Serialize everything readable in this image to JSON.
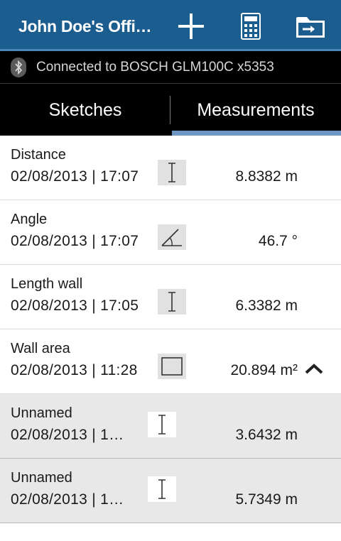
{
  "appbar": {
    "title": "John Doe's Offi…",
    "add_icon": "plus-icon",
    "calculator_icon": "calculator-icon",
    "folder_icon": "folder-icon",
    "color": "#1c5d8f"
  },
  "status": {
    "icon": "bluetooth-icon",
    "text": "Connected to BOSCH GLM100C x5353"
  },
  "tabs": [
    {
      "label": "Sketches",
      "selected": false
    },
    {
      "label": "Measurements",
      "selected": true
    }
  ],
  "tab_indicator_color": "#6f95c3",
  "measurements": [
    {
      "name": "Distance",
      "date": "02/08/2013 | 17:07",
      "icon": "distance-icon",
      "value": "8.8382 m"
    },
    {
      "name": "Angle",
      "date": "02/08/2013 | 17:07",
      "icon": "angle-icon",
      "value": "46.7 °"
    },
    {
      "name": "Length wall",
      "date": "02/08/2013 | 17:05",
      "icon": "distance-icon",
      "value": "6.3382 m"
    },
    {
      "name": "Wall area",
      "date": "02/08/2013 | 11:28",
      "icon": "area-icon",
      "value": "20.894 m²",
      "expanded": true,
      "children": [
        {
          "name": "Unnamed",
          "date": "02/08/2013 | 1…",
          "icon": "distance-icon",
          "value": "3.6432 m"
        },
        {
          "name": "Unnamed",
          "date": "02/08/2013 | 1…",
          "icon": "distance-icon",
          "value": "5.7349 m"
        }
      ]
    }
  ]
}
